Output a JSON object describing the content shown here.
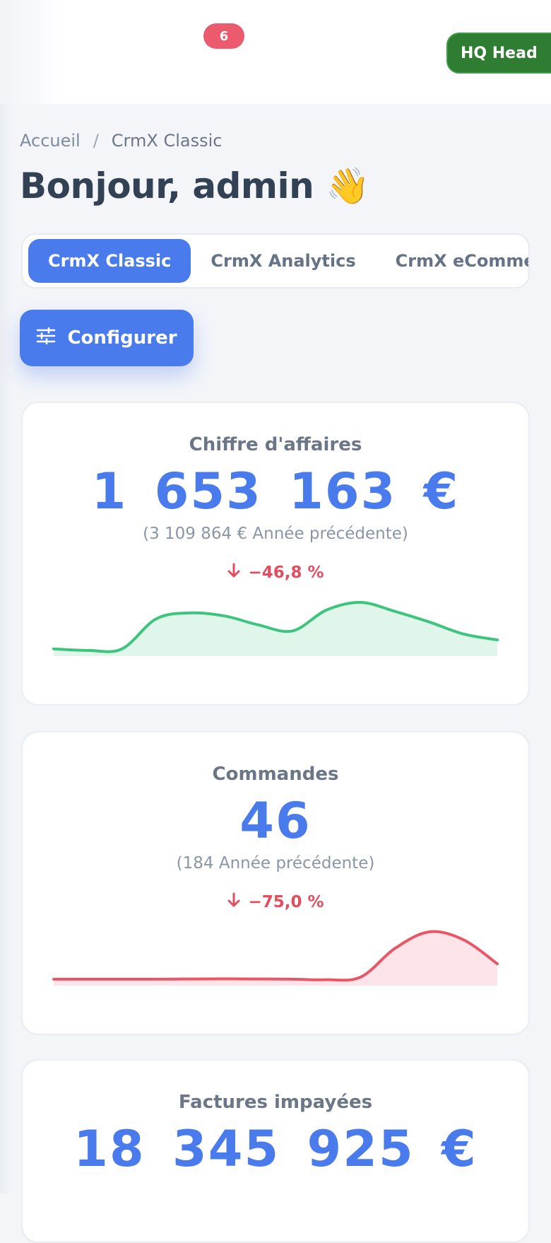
{
  "header": {
    "notifications_count": "6",
    "org_label": "HQ Head"
  },
  "breadcrumb": {
    "home": "Accueil",
    "separator": "/",
    "current": "CrmX Classic"
  },
  "greeting": "Bonjour, admin 👋",
  "tabs": [
    {
      "label": "CrmX Classic",
      "active": true
    },
    {
      "label": "CrmX Analytics",
      "active": false
    },
    {
      "label": "CrmX eCommerce",
      "active": false
    }
  ],
  "configure_label": "Configurer",
  "cards": [
    {
      "title": "Chiffre d'affaires",
      "value": "1 653 163 €",
      "previous": "(3 109 864 € Année précédente)",
      "delta": "−46,8 %",
      "trend_color": "#3ec47e",
      "fill_color": "#e0f6ea",
      "sparkline": [
        2,
        1,
        2,
        22,
        26,
        24,
        18,
        14,
        28,
        33,
        27,
        20,
        12,
        8
      ]
    },
    {
      "title": "Commandes",
      "value": "46",
      "previous": "(184 Année précédente)",
      "delta": "−75,0 %",
      "trend_color": "#e85768",
      "fill_color": "#fde4e8",
      "sparkline": [
        2,
        2,
        2,
        2,
        2.2,
        2.3,
        2.2,
        2,
        1.5,
        4,
        30,
        45,
        38,
        16
      ]
    },
    {
      "title": "Factures impayées",
      "value": "18 345 925 €"
    }
  ],
  "colors": {
    "accent": "#4a7bec",
    "negative": "#e24d5f",
    "badge": "#ec5a6e",
    "org_pill": "#2e7d32"
  }
}
